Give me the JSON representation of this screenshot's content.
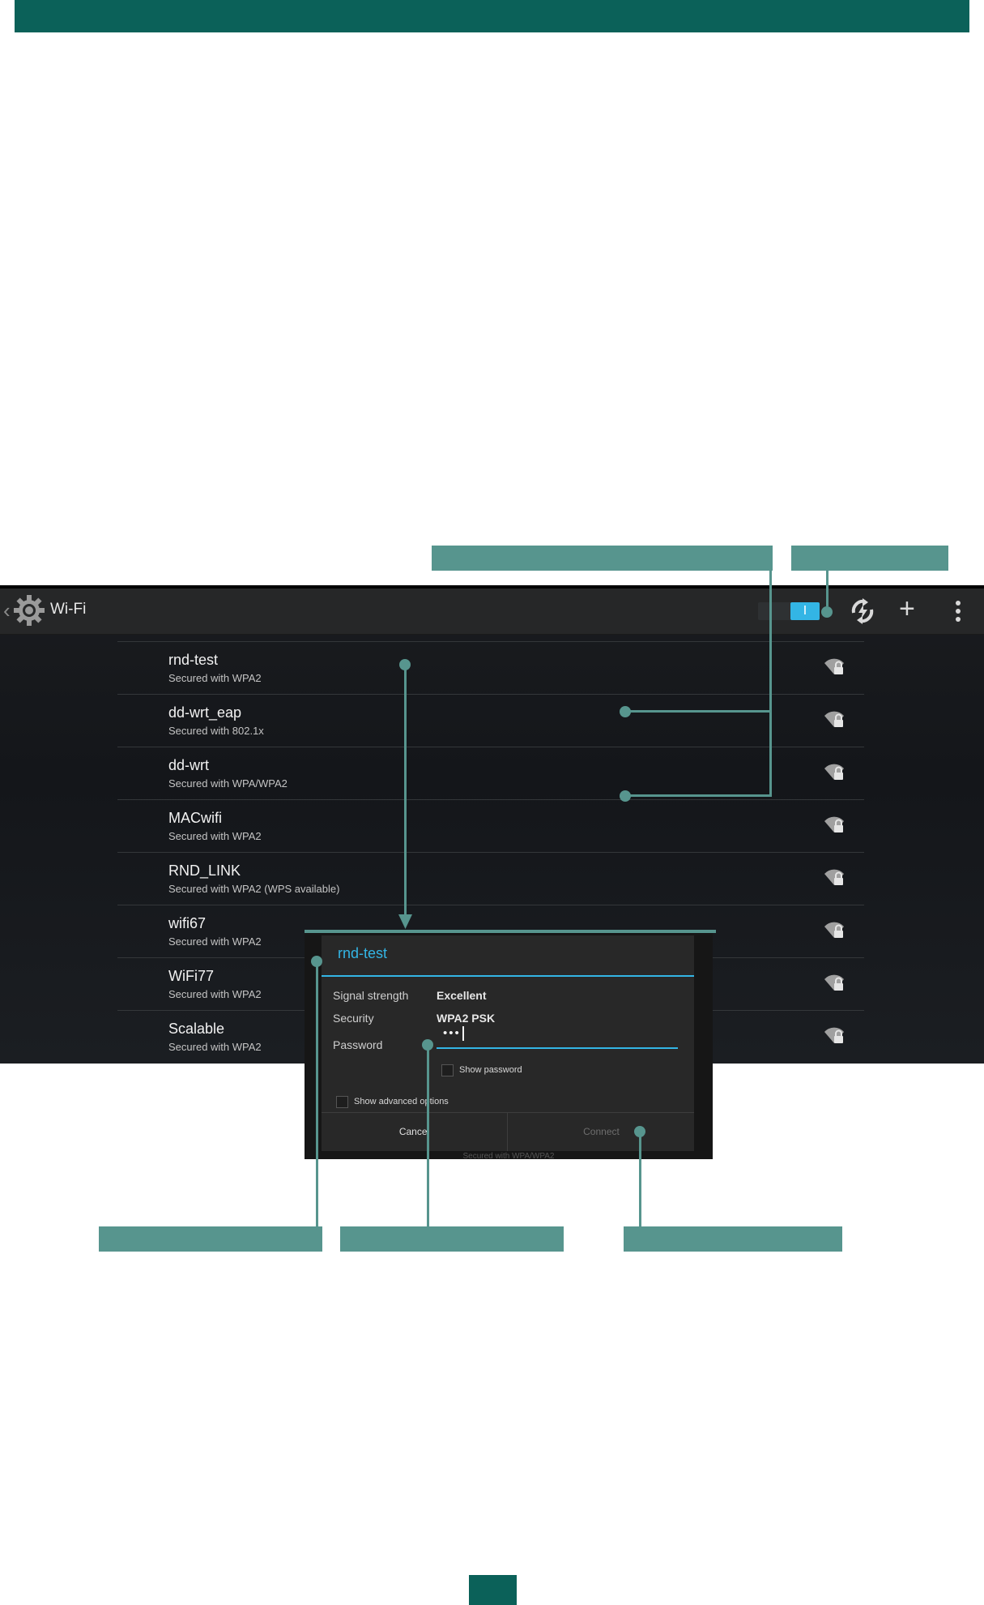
{
  "action_bar": {
    "back_glyph": "‹",
    "title": "Wi-Fi",
    "toggle_state": "I",
    "icons": [
      "settings-gear-icon",
      "wps-icon",
      "add-network-icon",
      "overflow-menu-icon"
    ]
  },
  "networks": [
    {
      "name": "rnd-test",
      "security": "Secured with WPA2"
    },
    {
      "name": "dd-wrt_eap",
      "security": "Secured with 802.1x"
    },
    {
      "name": "dd-wrt",
      "security": "Secured with WPA/WPA2"
    },
    {
      "name": "MACwifi",
      "security": "Secured with WPA2"
    },
    {
      "name": "RND_LINK",
      "security": "Secured with WPA2 (WPS available)"
    },
    {
      "name": "wifi67",
      "security": "Secured with WPA2"
    },
    {
      "name": "WiFi77",
      "security": "Secured with WPA2"
    },
    {
      "name": "Scalable",
      "security": "Secured with WPA2"
    }
  ],
  "dialog": {
    "title": "rnd-test",
    "signal_label": "Signal strength",
    "signal_value": "Excellent",
    "security_label": "Security",
    "security_value": "WPA2 PSK",
    "password_label": "Password",
    "password_value": "•••",
    "show_password": "Show password",
    "show_advanced": "Show advanced options",
    "cancel": "Cancel",
    "connect": "Connect",
    "behind_text": "Secured with WPA/WPA2"
  },
  "colors": {
    "accent_green": "#0b6159",
    "callout": "#57958e",
    "holo_blue": "#33b5e5"
  }
}
